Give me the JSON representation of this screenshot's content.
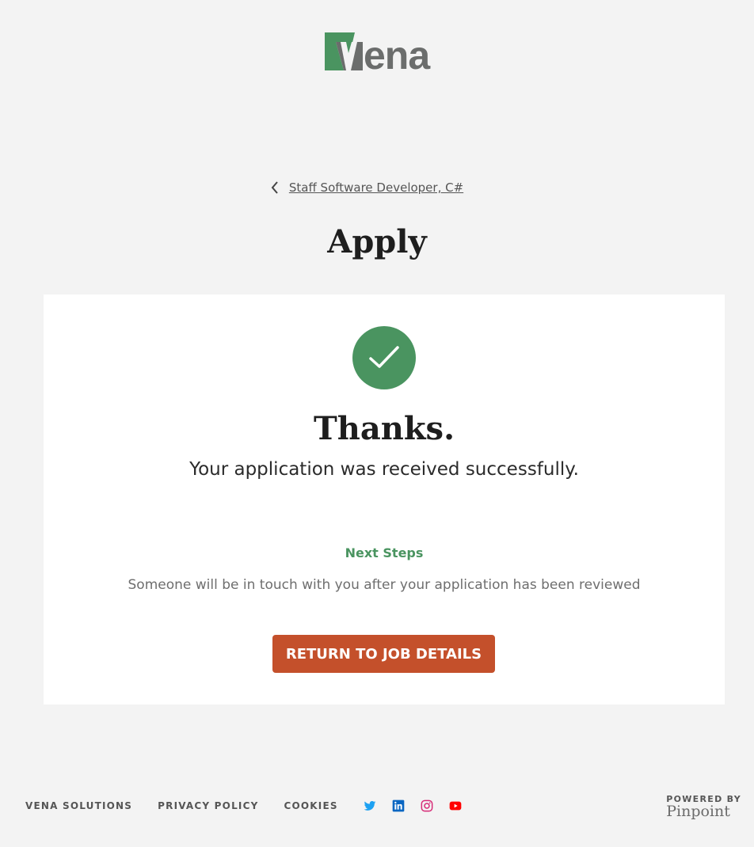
{
  "brand": {
    "logo_text": "ena",
    "logo_alt": "Vena",
    "colors": {
      "green": "#4a9460",
      "gray": "#6b6d6c",
      "accent": "#c4502b"
    }
  },
  "nav": {
    "back_icon": "chevron-left-icon",
    "back_label": "Staff Software Developer, C#"
  },
  "page": {
    "title": "Apply"
  },
  "confirmation": {
    "icon": "checkmark-icon",
    "heading": "Thanks.",
    "message": "Your application was received successfully.",
    "next_steps_label": "Next Steps",
    "next_steps_text": "Someone will be in touch with you after your application has been reviewed",
    "return_button": "RETURN TO JOB DETAILS"
  },
  "footer": {
    "links": [
      "VENA SOLUTIONS",
      "PRIVACY POLICY",
      "COOKIES"
    ],
    "socials": [
      "twitter-icon",
      "linkedin-icon",
      "instagram-icon",
      "youtube-icon"
    ],
    "powered_by": "POWERED BY",
    "powered_brand": "Pinpoint"
  }
}
